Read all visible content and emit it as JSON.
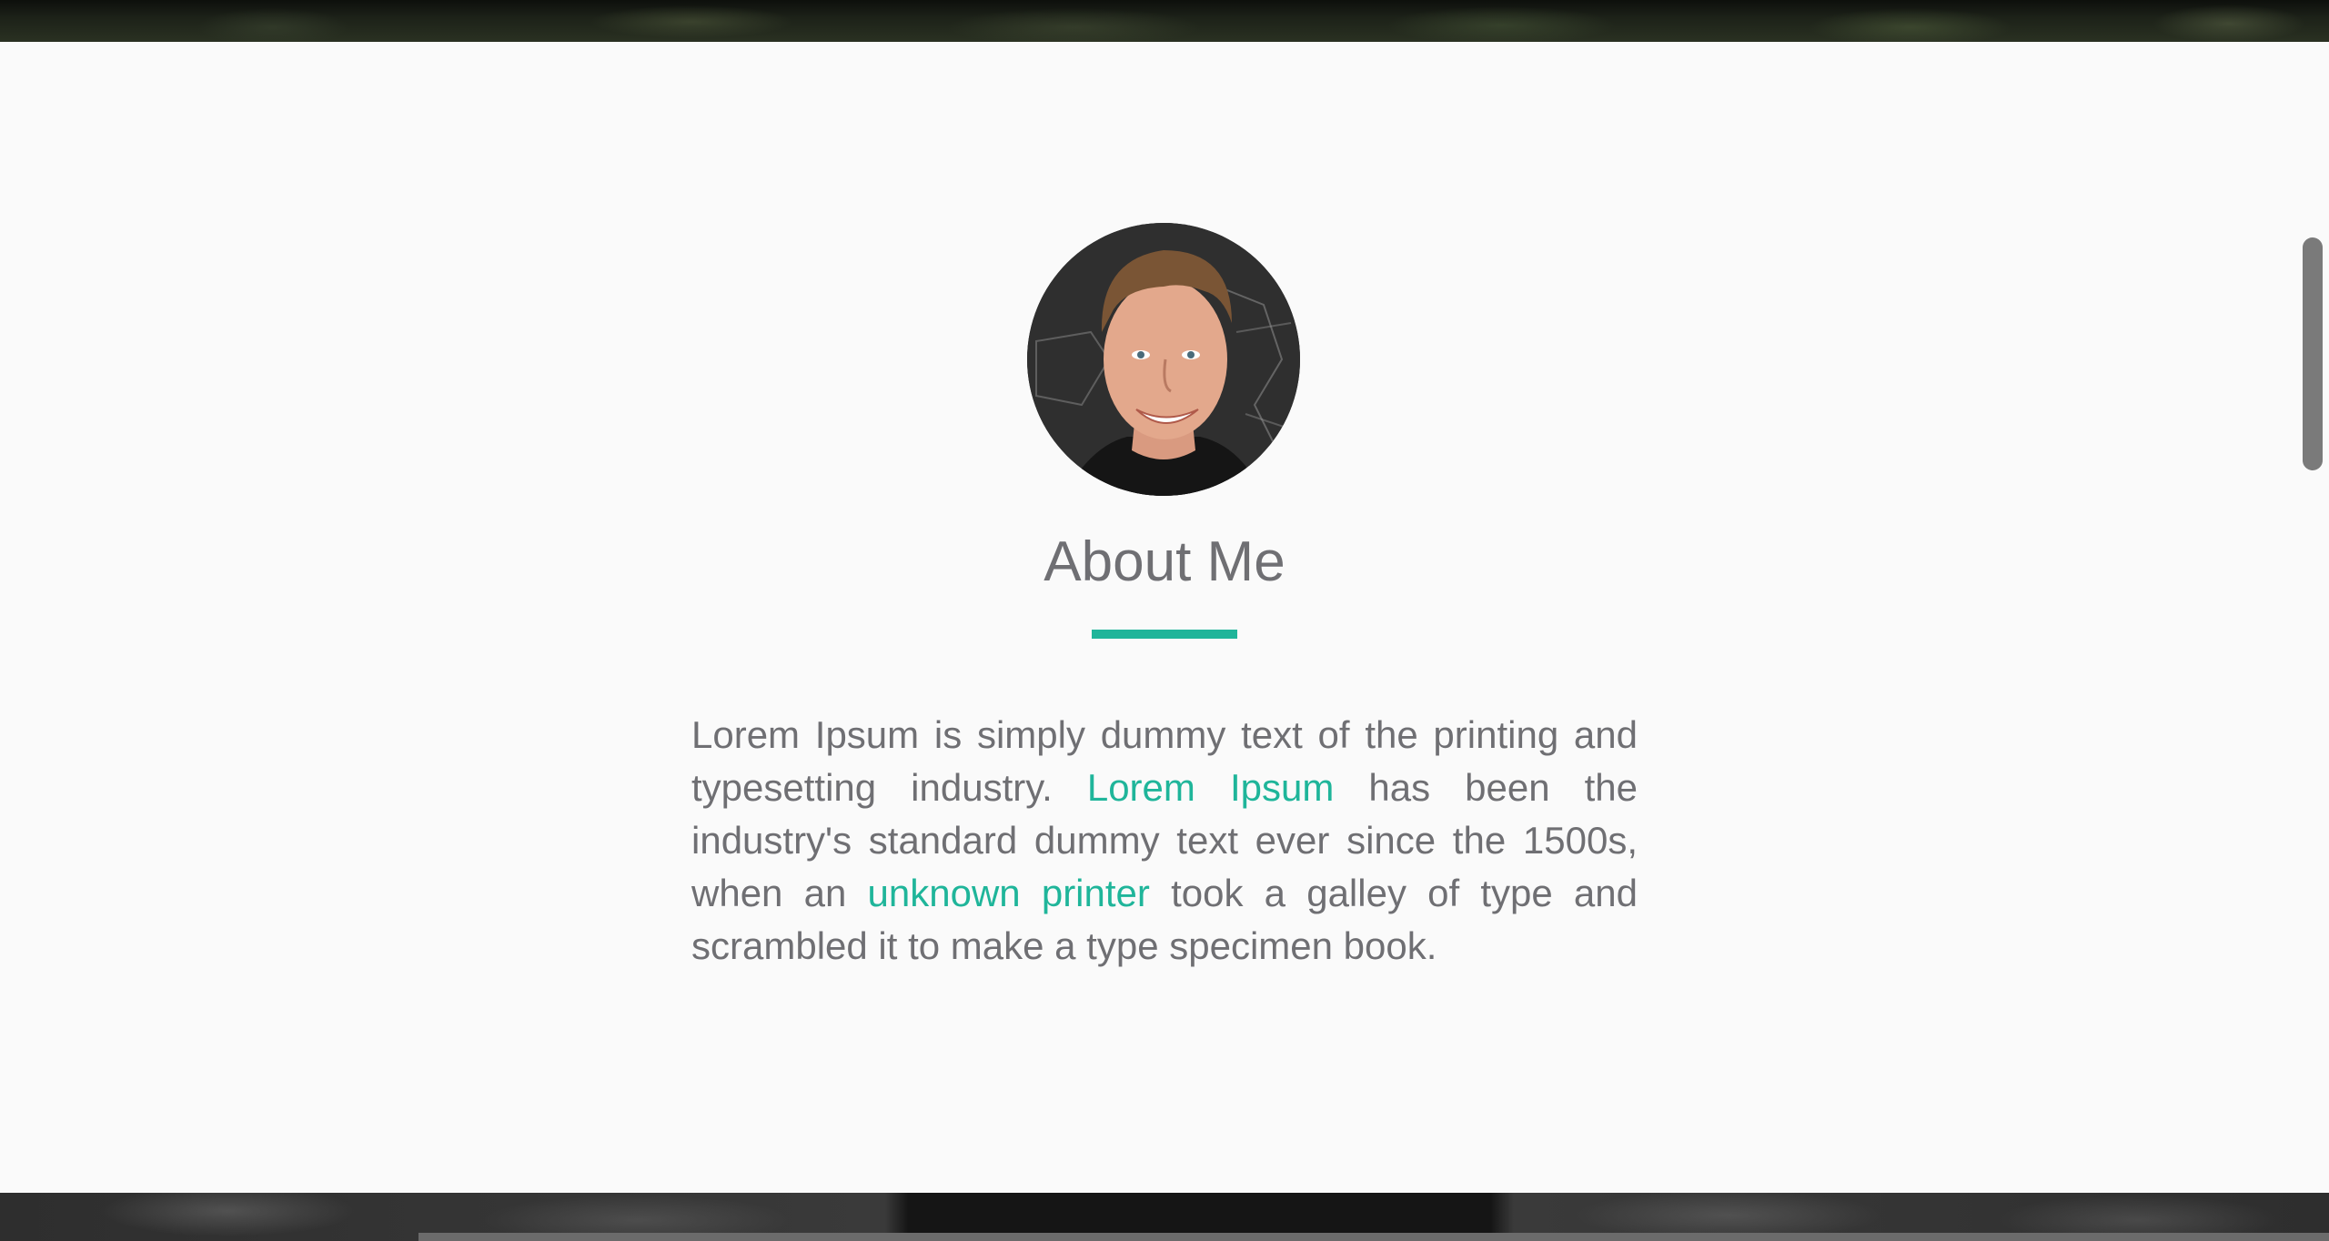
{
  "about": {
    "title": "About Me",
    "bio_part1": "Lorem Ipsum is simply dummy text of the printing and typesetting industry. ",
    "bio_link1": "Lorem Ipsum",
    "bio_part2": " has been the industry's standard dummy text ever since the 1500s, when an ",
    "bio_link2": "unknown printer",
    "bio_part3": " took a galley of type and scrambled it to make a type specimen book."
  },
  "colors": {
    "accent": "#1fb59a",
    "text": "#6f6f73",
    "background": "#fafafa"
  }
}
